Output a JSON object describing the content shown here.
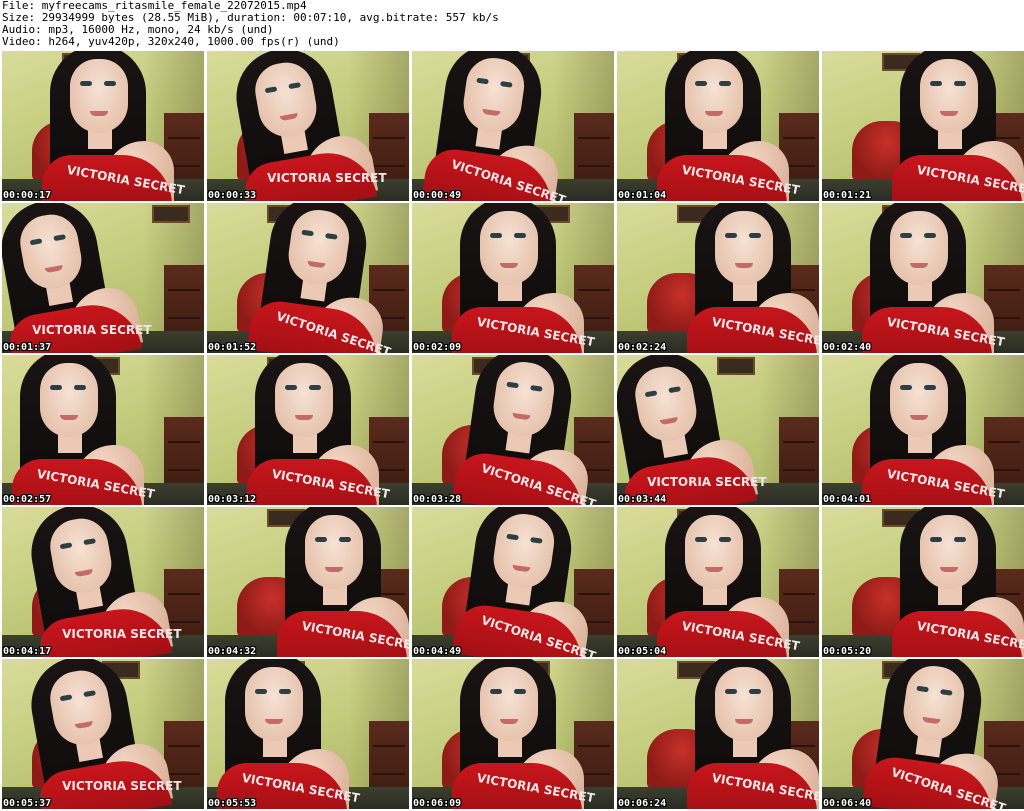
{
  "header": {
    "file": "File: myfreecams_ritasmile_female_22072015.mp4",
    "size": "Size: 29934999 bytes (28.55 MiB), duration: 00:07:10, avg.bitrate: 557 kb/s",
    "audio": "Audio: mp3, 16000 Hz, mono, 24 kb/s (und)",
    "video": "Video: h264, yuv420p, 320x240, 1000.00 fps(r) (und)"
  },
  "shirt_text": "VICTORIA SECRET",
  "thumbnails": [
    {
      "timestamp": "00:00:17"
    },
    {
      "timestamp": "00:00:33"
    },
    {
      "timestamp": "00:00:49"
    },
    {
      "timestamp": "00:01:04"
    },
    {
      "timestamp": "00:01:21"
    },
    {
      "timestamp": "00:01:37"
    },
    {
      "timestamp": "00:01:52"
    },
    {
      "timestamp": "00:02:09"
    },
    {
      "timestamp": "00:02:24"
    },
    {
      "timestamp": "00:02:40"
    },
    {
      "timestamp": "00:02:57"
    },
    {
      "timestamp": "00:03:12"
    },
    {
      "timestamp": "00:03:28"
    },
    {
      "timestamp": "00:03:44"
    },
    {
      "timestamp": "00:04:01"
    },
    {
      "timestamp": "00:04:17"
    },
    {
      "timestamp": "00:04:32"
    },
    {
      "timestamp": "00:04:49"
    },
    {
      "timestamp": "00:05:04"
    },
    {
      "timestamp": "00:05:20"
    },
    {
      "timestamp": "00:05:37"
    },
    {
      "timestamp": "00:05:53"
    },
    {
      "timestamp": "00:06:09"
    },
    {
      "timestamp": "00:06:24"
    },
    {
      "timestamp": "00:06:40"
    }
  ]
}
